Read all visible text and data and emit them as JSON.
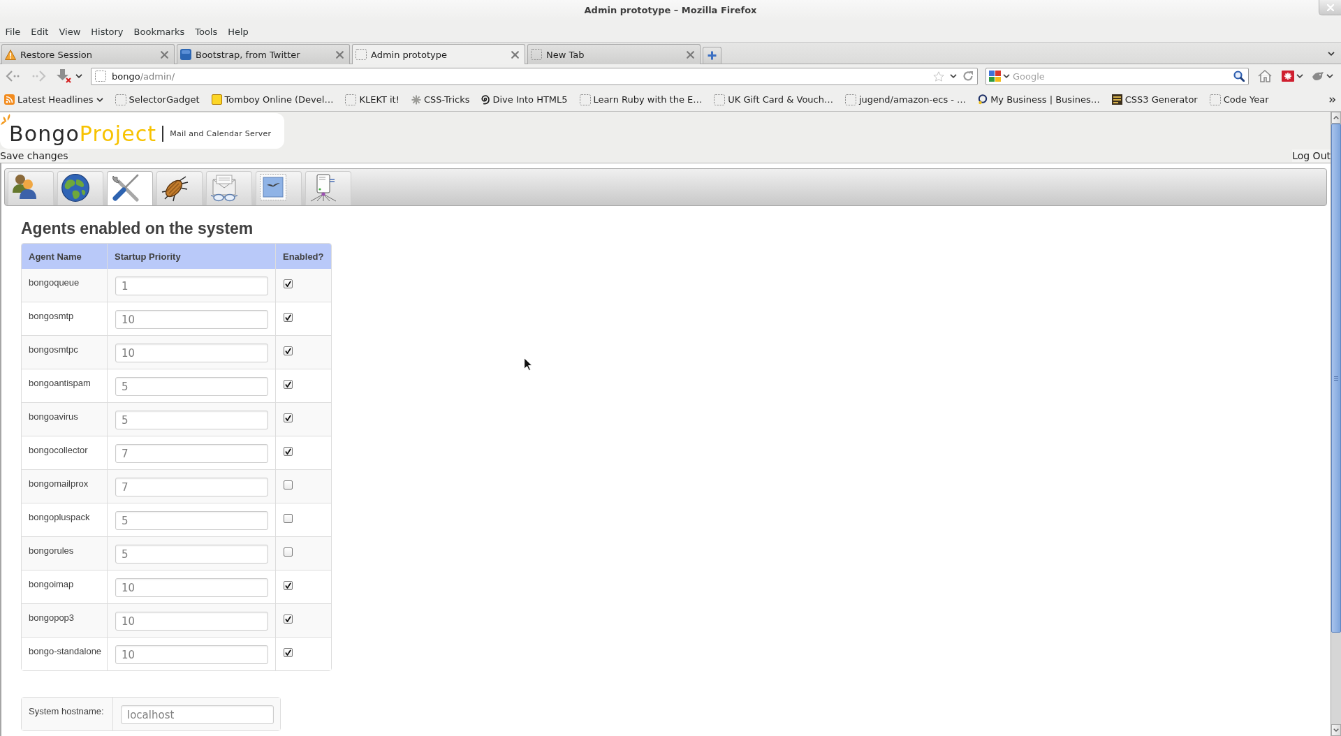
{
  "window": {
    "title": "Admin prototype – Mozilla Firefox"
  },
  "menu": [
    "File",
    "Edit",
    "View",
    "History",
    "Bookmarks",
    "Tools",
    "Help"
  ],
  "tabs": [
    {
      "label": "Restore Session",
      "kind": "warning",
      "selected": false
    },
    {
      "label": "Bootstrap, from Twitter",
      "kind": "tile",
      "selected": false
    },
    {
      "label": "Admin prototype",
      "kind": "blank",
      "selected": true
    },
    {
      "label": "New Tab",
      "kind": "blank",
      "selected": false
    }
  ],
  "address_bar": {
    "host": "bongo",
    "path": "/admin/"
  },
  "search": {
    "placeholder": "Google"
  },
  "bookmarks": [
    {
      "label": "Latest Headlines",
      "kind": "feed"
    },
    {
      "label": "SelectorGadget",
      "kind": "blank"
    },
    {
      "label": "Tomboy Online (Devel…",
      "kind": "note"
    },
    {
      "label": "KLEKT it!",
      "kind": "blank"
    },
    {
      "label": "CSS-Tricks",
      "kind": "asterisk"
    },
    {
      "label": "Dive Into HTML5",
      "kind": "swirl"
    },
    {
      "label": "Learn Ruby with the E…",
      "kind": "blank"
    },
    {
      "label": "UK Gift Card & Vouch…",
      "kind": "blank"
    },
    {
      "label": "jugend/amazon-ecs - …",
      "kind": "blank"
    },
    {
      "label": "My Business | Busines…",
      "kind": "ring"
    },
    {
      "label": "CSS3 Generator",
      "kind": "tile"
    },
    {
      "label": "Code Year",
      "kind": "blank"
    }
  ],
  "page": {
    "logo": {
      "name": "Bongo",
      "accent": "Project",
      "tagline": "Mail and Calendar Server"
    },
    "actions": {
      "save": "Save changes",
      "logout": "Log Out"
    },
    "sections": [
      {
        "kind": "users",
        "selected": false
      },
      {
        "kind": "globe",
        "selected": false
      },
      {
        "kind": "tools",
        "selected": true
      },
      {
        "kind": "bug",
        "selected": false
      },
      {
        "kind": "mail",
        "selected": false
      },
      {
        "kind": "stamp",
        "selected": false
      },
      {
        "kind": "server",
        "selected": false
      }
    ],
    "agents": {
      "title": "Agents enabled on the system",
      "columns": [
        "Agent Name",
        "Startup Priority",
        "Enabled?"
      ],
      "rows": [
        {
          "name": "bongoqueue",
          "priority": "1",
          "enabled": true
        },
        {
          "name": "bongosmtp",
          "priority": "10",
          "enabled": true
        },
        {
          "name": "bongosmtpc",
          "priority": "10",
          "enabled": true
        },
        {
          "name": "bongoantispam",
          "priority": "5",
          "enabled": true
        },
        {
          "name": "bongoavirus",
          "priority": "5",
          "enabled": true
        },
        {
          "name": "bongocollector",
          "priority": "7",
          "enabled": true
        },
        {
          "name": "bongomailprox",
          "priority": "7",
          "enabled": false
        },
        {
          "name": "bongopluspack",
          "priority": "5",
          "enabled": false
        },
        {
          "name": "bongorules",
          "priority": "5",
          "enabled": false
        },
        {
          "name": "bongoimap",
          "priority": "10",
          "enabled": true
        },
        {
          "name": "bongopop3",
          "priority": "10",
          "enabled": true
        },
        {
          "name": "bongo-standalone",
          "priority": "10",
          "enabled": true
        }
      ]
    },
    "settings": [
      {
        "label": "System hostname:",
        "value": "localhost"
      }
    ]
  }
}
